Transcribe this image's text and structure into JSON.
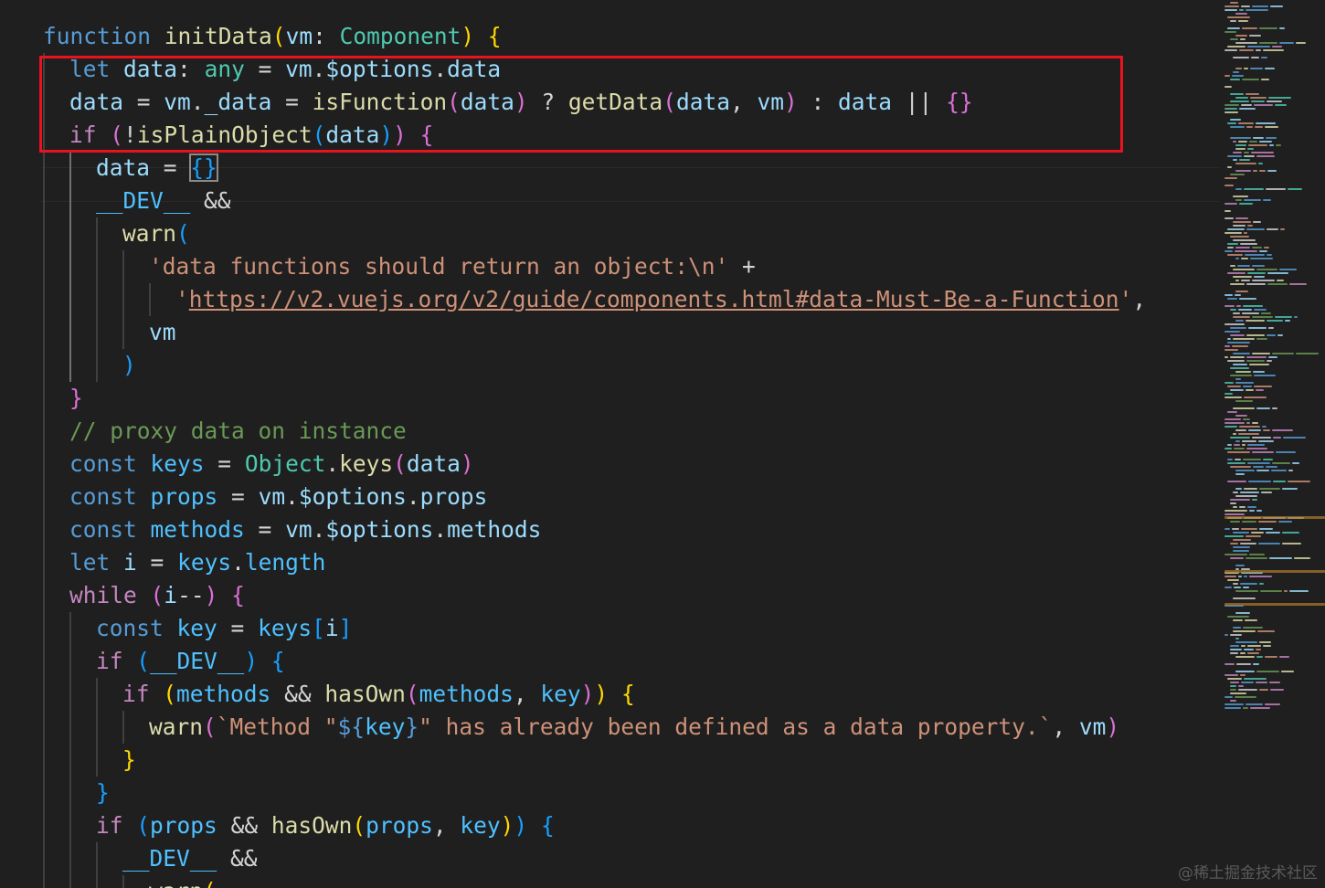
{
  "editor": {
    "line1": {
      "kw": "function",
      "fn": "initData",
      "p1": "(",
      "vm": "vm",
      "colon": ": ",
      "type": "Component",
      "p2": ")",
      "sp": " ",
      "brace": "{"
    },
    "line2": {
      "kw": "let",
      "sp1": " ",
      "data": "data",
      "colon": ": ",
      "any": "any",
      "eq": " = ",
      "vm": "vm",
      "dot": ".",
      "opts": "$options",
      "dot2": ".",
      "data2": "data"
    },
    "line3": {
      "data": "data",
      "eq": " = ",
      "vm": "vm",
      "dot": ".",
      "_data": "_data",
      "eq2": " = ",
      "fn": "isFunction",
      "p1": "(",
      "arg": "data",
      "p2": ")",
      "tern": " ? ",
      "fn2": "getData",
      "p3": "(",
      "a1": "data",
      "comma": ", ",
      "a2": "vm",
      "p4": ")",
      "colon": " : ",
      "d": "data",
      "or": " || ",
      "obj": "{}"
    },
    "line4": {
      "kw": "if",
      "sp": " ",
      "p1": "(",
      "not": "!",
      "fn": "isPlainObject",
      "p2": "(",
      "arg": "data",
      "p3": ")",
      "p4": ")",
      "sp2": " ",
      "brace": "{"
    },
    "line5": {
      "data": "data",
      "eq": " = ",
      "obj": "{}"
    },
    "line6": {
      "dev": "__DEV__",
      "and": " &&"
    },
    "line7": {
      "fn": "warn",
      "p": "("
    },
    "line8": {
      "str": "'data functions should return an object:\\n'",
      "plus": " +"
    },
    "line9": {
      "q1": "'",
      "url": "https://v2.vuejs.org/v2/guide/components.html#data-Must-Be-a-Function",
      "q2": "'",
      "comma": ","
    },
    "line10": {
      "vm": "vm"
    },
    "line11": {
      "p": ")"
    },
    "line12": {
      "brace": "}"
    },
    "line13": {
      "comment": "// proxy data on instance"
    },
    "line14": {
      "kw": "const",
      "sp": " ",
      "name": "keys",
      "eq": " = ",
      "obj": "Object",
      "dot": ".",
      "fn": "keys",
      "p1": "(",
      "arg": "data",
      "p2": ")"
    },
    "line15": {
      "kw": "const",
      "sp": " ",
      "name": "props",
      "eq": " = ",
      "vm": "vm",
      "dot": ".",
      "opts": "$options",
      "dot2": ".",
      "prop": "props"
    },
    "line16": {
      "kw": "const",
      "sp": " ",
      "name": "methods",
      "eq": " = ",
      "vm": "vm",
      "dot": ".",
      "opts": "$options",
      "dot2": ".",
      "prop": "methods"
    },
    "line17": {
      "kw": "let",
      "sp": " ",
      "name": "i",
      "eq": " = ",
      "keys": "keys",
      "dot": ".",
      "prop": "length"
    },
    "line18": {
      "kw": "while",
      "sp": " ",
      "p1": "(",
      "i": "i",
      "dec": "--",
      "p2": ")",
      "sp2": " ",
      "brace": "{"
    },
    "line19": {
      "kw": "const",
      "sp": " ",
      "name": "key",
      "eq": " = ",
      "keys": "keys",
      "b1": "[",
      "i": "i",
      "b2": "]"
    },
    "line20": {
      "kw": "if",
      "sp": " ",
      "p1": "(",
      "dev": "__DEV__",
      "p2": ")",
      "sp2": " ",
      "brace": "{"
    },
    "line21": {
      "kw": "if",
      "sp": " ",
      "p1": "(",
      "m": "methods",
      "and": " && ",
      "fn": "hasOwn",
      "p2": "(",
      "a1": "methods",
      "comma": ", ",
      "a2": "key",
      "p3": ")",
      "p4": ")",
      "sp2": " ",
      "brace": "{"
    },
    "line22": {
      "fn": "warn",
      "p1": "(",
      "s1": "`Method \"",
      "t1": "${",
      "key": "key",
      "t2": "}",
      "s2": "\" has already been defined as a data property.`",
      "comma": ", ",
      "vm": "vm",
      "p2": ")"
    },
    "line23": {
      "brace": "}"
    },
    "line24": {
      "brace": "}"
    },
    "line25": {
      "kw": "if",
      "sp": " ",
      "p1": "(",
      "pr": "props",
      "and": " && ",
      "fn": "hasOwn",
      "p2": "(",
      "a1": "props",
      "comma": ", ",
      "a2": "key",
      "p3": ")",
      "p4": ")",
      "sp2": " ",
      "brace": "{"
    },
    "line26": {
      "dev": "__DEV__",
      "and": " &&"
    },
    "line27": {
      "fn": "warn",
      "p": "("
    }
  },
  "watermark": "@稀土掘金技术社区"
}
